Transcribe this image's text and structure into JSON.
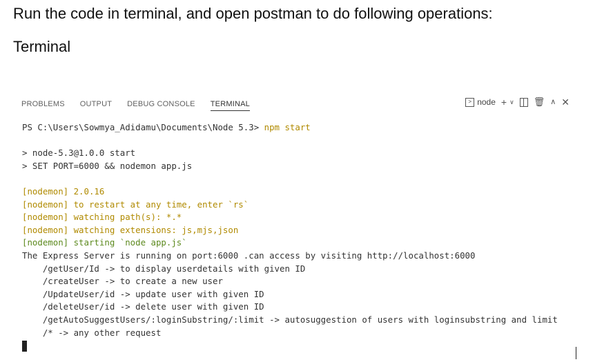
{
  "document": {
    "heading": "Run the code in terminal, and open postman to do following operations:",
    "subheading": "Terminal"
  },
  "panel": {
    "tabs": [
      {
        "label": "PROBLEMS",
        "active": false
      },
      {
        "label": "OUTPUT",
        "active": false
      },
      {
        "label": "DEBUG CONSOLE",
        "active": false
      },
      {
        "label": "TERMINAL",
        "active": true
      }
    ],
    "toolbar": {
      "terminal_name": "node",
      "icons": [
        "terminal-icon",
        "plus-icon",
        "chevron-down-icon",
        "split-icon",
        "trash-icon",
        "chevron-up-icon",
        "close-icon"
      ]
    }
  },
  "terminal": {
    "prompt": "PS C:\\Users\\Sowmya_Adidamu\\Documents\\Node 5.3> ",
    "command": "npm start",
    "lines": [
      "> node-5.3@1.0.0 start",
      "> SET PORT=6000 && nodemon app.js",
      "[nodemon] 2.0.16",
      "[nodemon] to restart at any time, enter `rs`",
      "[nodemon] watching path(s): *.*",
      "[nodemon] watching extensions: js,mjs,json",
      "[nodemon] starting `node app.js`",
      "The Express Server is running on port:6000 .can access by visiting http://localhost:6000",
      "    /getUser/Id -> to display userdetails with given ID",
      "    /createUser -> to create a new user",
      "    /UpdateUser/id -> update user with given ID",
      "    /deleteUser/id -> delete user with given ID",
      "    /getAutoSuggestUsers/:loginSubstring/:limit -> autosuggestion of users with loginsubstring and limit",
      "    /* -> any other request"
    ]
  },
  "colors": {
    "nodemon_info": "#b08a00",
    "nodemon_start": "#5d8a1f",
    "command": "#b08a00"
  }
}
